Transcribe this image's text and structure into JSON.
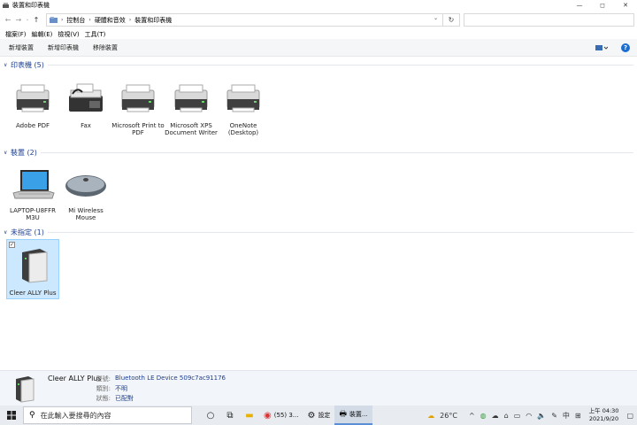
{
  "window": {
    "title": "裝置和印表機",
    "controls": {
      "minimize": "—",
      "maximize": "◻",
      "close": "✕"
    }
  },
  "address": {
    "crumbs": [
      "控制台",
      "硬體和音效",
      "裝置和印表機"
    ],
    "search_placeholder": ""
  },
  "menu": [
    "檔案(F)",
    "編輯(E)",
    "檢視(V)",
    "工具(T)"
  ],
  "commands": [
    "新增裝置",
    "新增印表機",
    "移除裝置"
  ],
  "groups": [
    {
      "title": "印表機 (5)",
      "items": [
        "Adobe PDF",
        "Fax",
        "Microsoft Print to PDF",
        "Microsoft XPS Document Writer",
        "OneNote (Desktop)"
      ]
    },
    {
      "title": "裝置 (2)",
      "items": [
        "LAPTOP-U8FFR M3U",
        "Mi Wireless Mouse"
      ]
    },
    {
      "title": "未指定 (1)",
      "items": [
        "Cleer ALLY Plus"
      ]
    }
  ],
  "details": {
    "name": "Cleer ALLY Plus",
    "model_label": "型號:",
    "model_value": "Bluetooth LE Device 509c7ac91176",
    "category_label": "類別:",
    "category_value": "不明",
    "status_label": "狀態:",
    "status_value": "已配對"
  },
  "taskbar": {
    "search_placeholder": "在此輸入要搜尋的內容",
    "apps": [
      "(55) 3...",
      "設定",
      "裝置..."
    ],
    "weather": "26°C",
    "ime": "中",
    "time": "上午 04:30",
    "date": "2021/9/20"
  },
  "colors": {
    "accent": "#1c3f94",
    "selection": "#cce8ff",
    "command_bar": "#f5f6f7"
  }
}
